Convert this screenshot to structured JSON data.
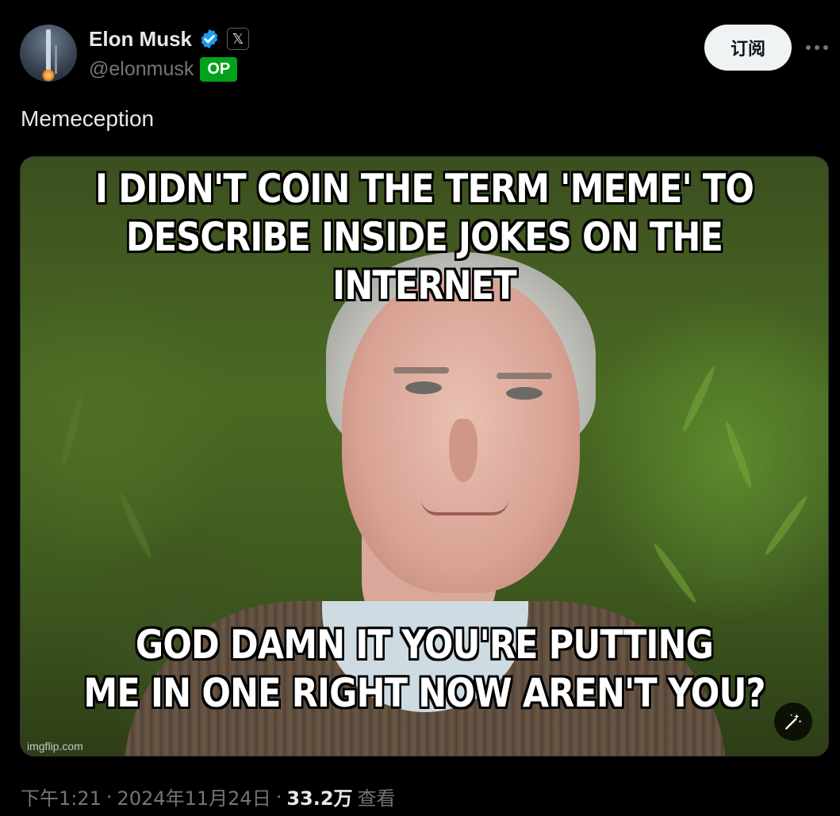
{
  "author": {
    "name": "Elon Musk",
    "handle": "@elonmusk",
    "op_badge": "OP",
    "verified_icon": "verified-check-icon",
    "affiliate_icon": "x-logo-icon",
    "affiliate_symbol": "𝕏"
  },
  "header": {
    "subscribe_label": "订阅",
    "more_icon": "more-horizontal-icon"
  },
  "tweet": {
    "text": "Memeception",
    "meme_top_line1": "I DIDN'T COIN THE TERM 'MEME' TO",
    "meme_top_line2": "DESCRIBE INSIDE JOKES ON THE INTERNET",
    "meme_bottom_line1": "GOD DAMN IT YOU'RE PUTTING",
    "meme_bottom_line2": "ME IN ONE RIGHT NOW AREN'T YOU?",
    "watermark": "imgflip.com",
    "edit_icon": "magic-wand-icon"
  },
  "footer": {
    "time": "下午1:21",
    "separator": "·",
    "date": "2024年11月24日",
    "views_count": "33.2万",
    "views_label": "查看"
  },
  "colors": {
    "background": "#000000",
    "primary_text": "#e7e9ea",
    "secondary_text": "#71767b",
    "verified_blue": "#1d9bf0",
    "op_green": "#00a11b"
  }
}
